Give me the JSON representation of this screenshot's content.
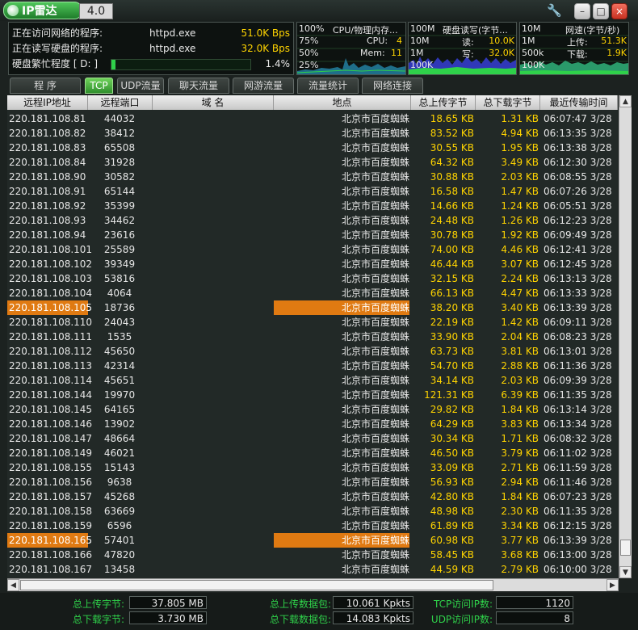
{
  "app": {
    "title": "IP雷达",
    "version": "4.0"
  },
  "window_buttons": {
    "minimize": "–",
    "maximize": "□",
    "close": "×"
  },
  "activity": {
    "net_label": "正在访问网络的程序:",
    "net_process": "httpd.exe",
    "net_value": "51.0K Bps",
    "disk_label": "正在读写硬盘的程序:",
    "disk_process": "httpd.exe",
    "disk_value": "32.0K Bps",
    "busy_label": "硬盘繁忙程度 [ D: ]",
    "busy_value": "1.4%",
    "busy_fraction": 0.014
  },
  "cpu_graph": {
    "title": "CPU/物理内存...",
    "scale_top": "100%",
    "scale_75": "75%",
    "scale_50": "50%",
    "scale_25": "25%",
    "cpu_label": "CPU:",
    "cpu_value": "4",
    "mem_label": "Mem:",
    "mem_value": "11"
  },
  "disk_graph": {
    "title": "硬盘读写(字节...",
    "scale_top": "100M",
    "scale_2": "10M",
    "scale_3": "1M",
    "scale_4": "100K",
    "read_label": "读:",
    "read_value": "10.0K",
    "write_label": "写:",
    "write_value": "32.0K"
  },
  "net_graph": {
    "title": "网速(字节/秒)",
    "scale_top": "10M",
    "scale_2": "1M",
    "scale_3": "500k",
    "scale_4": "100K",
    "up_label": "上传:",
    "up_value": "51.3K",
    "down_label": "下载:",
    "down_value": "1.9K"
  },
  "tabs": [
    "程  序",
    "TCP流量",
    "UDP流量",
    "聊天流量",
    "网游流量",
    "流量统计",
    "网络连接"
  ],
  "active_tab": 1,
  "columns": [
    "远程IP地址",
    "远程端口",
    "域  名",
    "地点",
    "总上传字节",
    "总下载字节",
    "最近传输时间"
  ],
  "rows": [
    {
      "ip": "220.181.108.81",
      "port": "44032",
      "domain": "",
      "loc": "北京市百度蜘蛛",
      "up": "18.65 KB",
      "down": "1.31 KB",
      "time": "06:07:47 3/28"
    },
    {
      "ip": "220.181.108.82",
      "port": "38412",
      "domain": "",
      "loc": "北京市百度蜘蛛",
      "up": "83.52 KB",
      "down": "4.94 KB",
      "time": "06:13:35 3/28"
    },
    {
      "ip": "220.181.108.83",
      "port": "65508",
      "domain": "",
      "loc": "北京市百度蜘蛛",
      "up": "30.55 KB",
      "down": "1.95 KB",
      "time": "06:13:38 3/28"
    },
    {
      "ip": "220.181.108.84",
      "port": "31928",
      "domain": "",
      "loc": "北京市百度蜘蛛",
      "up": "64.32 KB",
      "down": "3.49 KB",
      "time": "06:12:30 3/28"
    },
    {
      "ip": "220.181.108.90",
      "port": "30582",
      "domain": "",
      "loc": "北京市百度蜘蛛",
      "up": "30.88 KB",
      "down": "2.03 KB",
      "time": "06:08:55 3/28"
    },
    {
      "ip": "220.181.108.91",
      "port": "65144",
      "domain": "",
      "loc": "北京市百度蜘蛛",
      "up": "16.58 KB",
      "down": "1.47 KB",
      "time": "06:07:26 3/28"
    },
    {
      "ip": "220.181.108.92",
      "port": "35399",
      "domain": "",
      "loc": "北京市百度蜘蛛",
      "up": "14.66 KB",
      "down": "1.24 KB",
      "time": "06:05:51 3/28"
    },
    {
      "ip": "220.181.108.93",
      "port": "34462",
      "domain": "",
      "loc": "北京市百度蜘蛛",
      "up": "24.48 KB",
      "down": "1.26 KB",
      "time": "06:12:23 3/28"
    },
    {
      "ip": "220.181.108.94",
      "port": "23616",
      "domain": "",
      "loc": "北京市百度蜘蛛",
      "up": "30.78 KB",
      "down": "1.92 KB",
      "time": "06:09:49 3/28"
    },
    {
      "ip": "220.181.108.101",
      "port": "25589",
      "domain": "",
      "loc": "北京市百度蜘蛛",
      "up": "74.00 KB",
      "down": "4.46 KB",
      "time": "06:12:41 3/28"
    },
    {
      "ip": "220.181.108.102",
      "port": "39349",
      "domain": "",
      "loc": "北京市百度蜘蛛",
      "up": "46.44 KB",
      "down": "3.07 KB",
      "time": "06:12:45 3/28"
    },
    {
      "ip": "220.181.108.103",
      "port": "53816",
      "domain": "",
      "loc": "北京市百度蜘蛛",
      "up": "32.15 KB",
      "down": "2.24 KB",
      "time": "06:13:13 3/28"
    },
    {
      "ip": "220.181.108.104",
      "port": "4064",
      "domain": "",
      "loc": "北京市百度蜘蛛",
      "up": "66.13 KB",
      "down": "4.47 KB",
      "time": "06:13:33 3/28"
    },
    {
      "ip": "220.181.108.105",
      "port": "18736",
      "domain": "",
      "loc": "北京市百度蜘蛛",
      "up": "38.20 KB",
      "down": "3.40 KB",
      "time": "06:13:39 3/28",
      "highlight": true
    },
    {
      "ip": "220.181.108.110",
      "port": "24043",
      "domain": "",
      "loc": "北京市百度蜘蛛",
      "up": "22.19 KB",
      "down": "1.42 KB",
      "time": "06:09:11 3/28"
    },
    {
      "ip": "220.181.108.111",
      "port": "1535",
      "domain": "",
      "loc": "北京市百度蜘蛛",
      "up": "33.90 KB",
      "down": "2.04 KB",
      "time": "06:08:23 3/28"
    },
    {
      "ip": "220.181.108.112",
      "port": "45650",
      "domain": "",
      "loc": "北京市百度蜘蛛",
      "up": "63.73 KB",
      "down": "3.81 KB",
      "time": "06:13:01 3/28"
    },
    {
      "ip": "220.181.108.113",
      "port": "42314",
      "domain": "",
      "loc": "北京市百度蜘蛛",
      "up": "54.70 KB",
      "down": "2.88 KB",
      "time": "06:11:36 3/28"
    },
    {
      "ip": "220.181.108.114",
      "port": "45651",
      "domain": "",
      "loc": "北京市百度蜘蛛",
      "up": "34.14 KB",
      "down": "2.03 KB",
      "time": "06:09:39 3/28"
    },
    {
      "ip": "220.181.108.144",
      "port": "19970",
      "domain": "",
      "loc": "北京市百度蜘蛛",
      "up": "121.31 KB",
      "down": "6.39 KB",
      "time": "06:11:35 3/28"
    },
    {
      "ip": "220.181.108.145",
      "port": "64165",
      "domain": "",
      "loc": "北京市百度蜘蛛",
      "up": "29.82 KB",
      "down": "1.84 KB",
      "time": "06:13:14 3/28"
    },
    {
      "ip": "220.181.108.146",
      "port": "13902",
      "domain": "",
      "loc": "北京市百度蜘蛛",
      "up": "64.29 KB",
      "down": "3.83 KB",
      "time": "06:13:34 3/28"
    },
    {
      "ip": "220.181.108.147",
      "port": "48664",
      "domain": "",
      "loc": "北京市百度蜘蛛",
      "up": "30.34 KB",
      "down": "1.71 KB",
      "time": "06:08:32 3/28"
    },
    {
      "ip": "220.181.108.149",
      "port": "46021",
      "domain": "",
      "loc": "北京市百度蜘蛛",
      "up": "46.50 KB",
      "down": "3.79 KB",
      "time": "06:11:02 3/28"
    },
    {
      "ip": "220.181.108.155",
      "port": "15143",
      "domain": "",
      "loc": "北京市百度蜘蛛",
      "up": "33.09 KB",
      "down": "2.71 KB",
      "time": "06:11:59 3/28"
    },
    {
      "ip": "220.181.108.156",
      "port": "9638",
      "domain": "",
      "loc": "北京市百度蜘蛛",
      "up": "56.93 KB",
      "down": "2.94 KB",
      "time": "06:11:46 3/28"
    },
    {
      "ip": "220.181.108.157",
      "port": "45268",
      "domain": "",
      "loc": "北京市百度蜘蛛",
      "up": "42.80 KB",
      "down": "1.84 KB",
      "time": "06:07:23 3/28"
    },
    {
      "ip": "220.181.108.158",
      "port": "63669",
      "domain": "",
      "loc": "北京市百度蜘蛛",
      "up": "48.98 KB",
      "down": "2.30 KB",
      "time": "06:11:35 3/28"
    },
    {
      "ip": "220.181.108.159",
      "port": "6596",
      "domain": "",
      "loc": "北京市百度蜘蛛",
      "up": "61.89 KB",
      "down": "3.34 KB",
      "time": "06:12:15 3/28"
    },
    {
      "ip": "220.181.108.165",
      "port": "57401",
      "domain": "",
      "loc": "北京市百度蜘蛛",
      "up": "60.98 KB",
      "down": "3.77 KB",
      "time": "06:13:39 3/28",
      "highlight": true
    },
    {
      "ip": "220.181.108.166",
      "port": "47820",
      "domain": "",
      "loc": "北京市百度蜘蛛",
      "up": "58.45 KB",
      "down": "3.68 KB",
      "time": "06:13:00 3/28"
    },
    {
      "ip": "220.181.108.167",
      "port": "13458",
      "domain": "",
      "loc": "北京市百度蜘蛛",
      "up": "44.59 KB",
      "down": "2.79 KB",
      "time": "06:10:00 3/28"
    }
  ],
  "footer": {
    "total_up_label": "总上传字节:",
    "total_up_value": "37.805 MB",
    "total_down_label": "总下载字节:",
    "total_down_value": "3.730 MB",
    "pkt_up_label": "总上传数据包:",
    "pkt_up_value": "10.061 Kpkts",
    "pkt_down_label": "总下载数据包:",
    "pkt_down_value": "14.083 Kpkts",
    "tcp_label": "TCP访问IP数:",
    "tcp_value": "1120",
    "udp_label": "UDP访问IP数:",
    "udp_value": "8"
  },
  "colors": {
    "accent_green": "#2fd14a",
    "value_yellow": "#ffd400",
    "highlight_orange": "#e07a12"
  }
}
